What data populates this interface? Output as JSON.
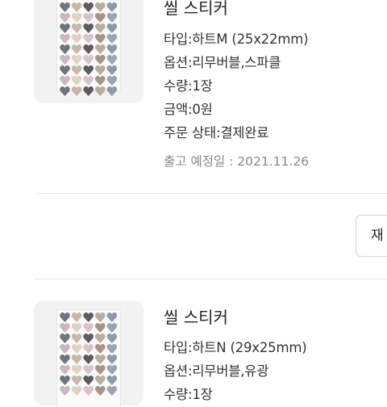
{
  "orders": [
    {
      "title": "씰 스티커",
      "details": [
        "타입:하트M (25x22mm)",
        "옵션:리무버블,스파클",
        "수량:1장",
        "금액:0원",
        "주문 상태:결제완료"
      ],
      "ship_date": "출고 예정일 : 2021.11.26"
    },
    {
      "title": "씰 스티커",
      "details": [
        "타입:하트N (29x25mm)",
        "옵션:리무버블,유광",
        "수량:1장"
      ]
    }
  ],
  "action_button_label": "재",
  "colors": {
    "thumb_bg": "#f2f2f2",
    "text_primary": "#222222",
    "text_muted": "#8a8a8a",
    "divider": "#e9e9e9"
  }
}
